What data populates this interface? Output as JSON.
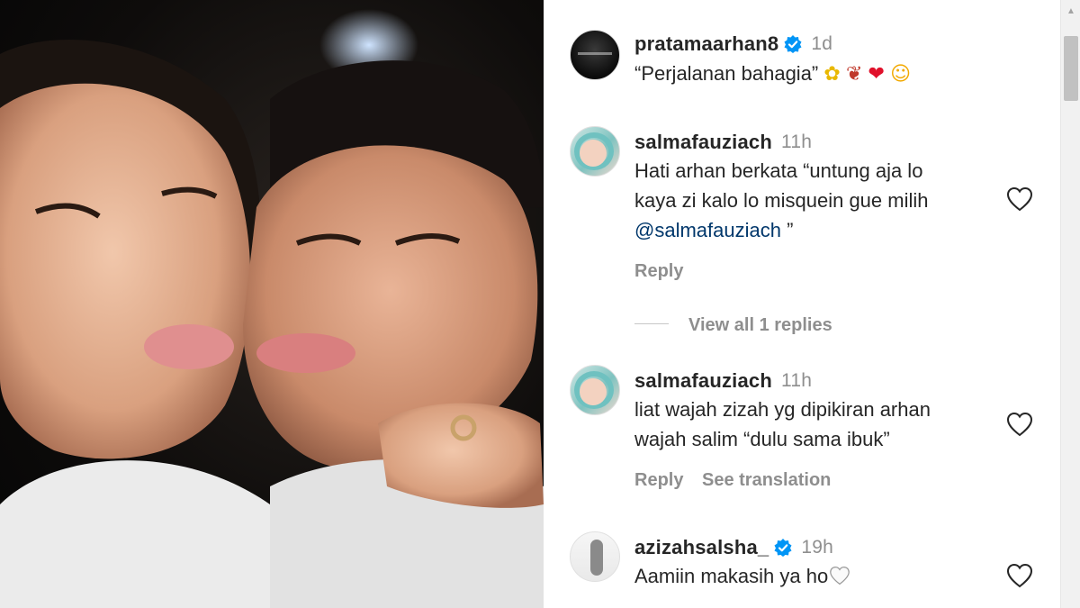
{
  "post": {
    "author": "pratamaarhan8",
    "age": "1d",
    "caption": "“Perjalanan bahagia”",
    "caption_emojis": [
      "sunflower-icon",
      "butterfly-icon",
      "heart-icon",
      "kiss-face-icon"
    ]
  },
  "comments": [
    {
      "user": "salmafauziach",
      "age": "11h",
      "lines": [
        "Hati arhan berkata “untung aja lo",
        "kaya zi kalo lo misquein gue milih"
      ],
      "mention": "@salmafauziach",
      "mention_suffix": " ”",
      "reply_label": "Reply",
      "view_replies_label": "View all 1 replies"
    },
    {
      "user": "salmafauziach",
      "age": "11h",
      "lines": [
        "liat wajah zizah yg dipikiran arhan",
        "wajah salim “dulu sama ibuk”"
      ],
      "reply_label": "Reply",
      "translate_label": "See translation"
    },
    {
      "user": "azizahsalsha_",
      "age": "19h",
      "text": "Aamiin makasih ya ho"
    }
  ],
  "colors": {
    "verified": "#0095f6",
    "mention": "#00376b",
    "muted": "#8e8e8e",
    "text": "#262626"
  }
}
